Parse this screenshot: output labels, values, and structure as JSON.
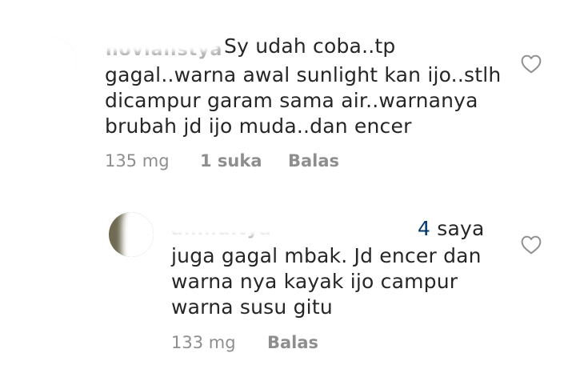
{
  "comments": [
    {
      "username": "novialistya",
      "text_lines": [
        "Sy udah coba..tp",
        "gagal..warna awal sunlight kan ijo..stlh",
        "dicampur garam sama air..warnanya",
        "brubah jd ijo muda..dan encer"
      ],
      "time": "135 mg",
      "likes": "1 suka",
      "reply": "Balas",
      "like_icon": "heart-outline-icon"
    },
    {
      "username": "aninditya",
      "mention_tail": "4",
      "text_first": " saya",
      "text_lines": [
        "juga gagal mbak. Jd encer dan",
        "warna nya kayak ijo campur",
        "warna susu gitu"
      ],
      "time": "133 mg",
      "reply": "Balas",
      "like_icon": "heart-outline-icon"
    }
  ],
  "colors": {
    "text": "#262626",
    "meta": "#8e8e8e",
    "mention": "#00376b",
    "background": "#ffffff"
  }
}
